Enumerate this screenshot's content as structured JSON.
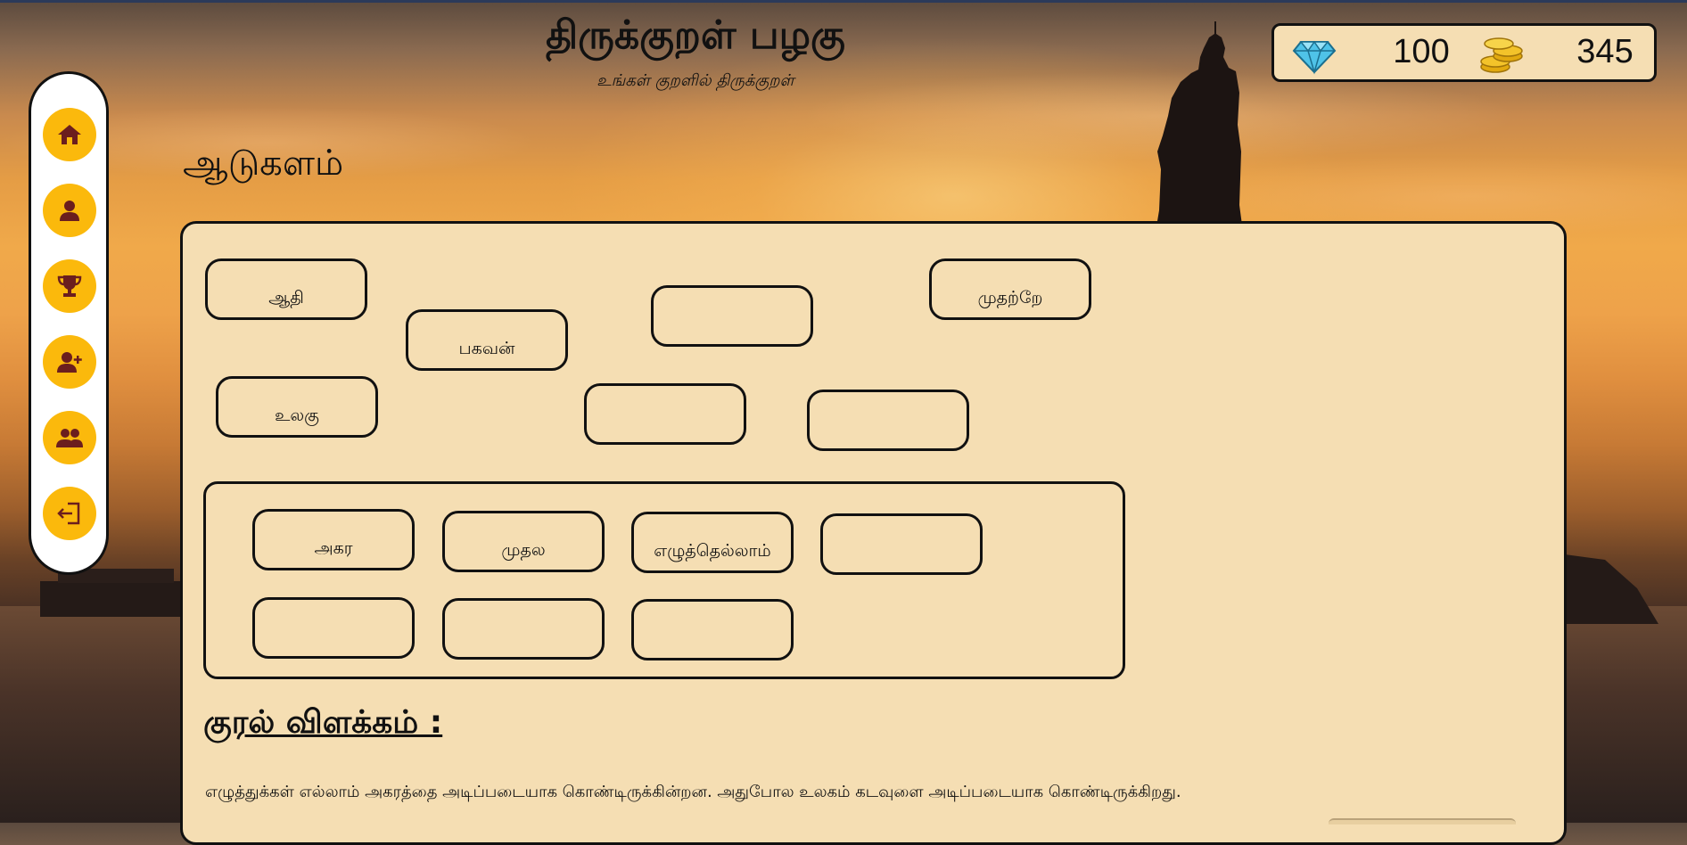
{
  "app": {
    "title": "திருக்குறள் பழகு",
    "subtitle": "உங்கள் குறளில் திருக்குறள்"
  },
  "wallet": {
    "gem_icon": "diamond-icon",
    "gems": "100",
    "coin_icon": "coins-icon",
    "coins": "345"
  },
  "sidebar": {
    "items": [
      {
        "id": "home",
        "icon": "home-icon"
      },
      {
        "id": "profile",
        "icon": "user-icon"
      },
      {
        "id": "leaderboard",
        "icon": "trophy-icon"
      },
      {
        "id": "add-friend",
        "icon": "user-plus-icon"
      },
      {
        "id": "friends",
        "icon": "users-icon"
      },
      {
        "id": "logout",
        "icon": "logout-icon"
      }
    ]
  },
  "section": {
    "title": "ஆடுகளம்"
  },
  "word_pool": [
    {
      "label": "ஆதி"
    },
    {
      "label": "பகவன்"
    },
    {
      "label": ""
    },
    {
      "label": "முதற்றே"
    },
    {
      "label": "உலகு"
    },
    {
      "label": ""
    },
    {
      "label": ""
    }
  ],
  "answer_slots": [
    {
      "label": "அகர"
    },
    {
      "label": "முதல"
    },
    {
      "label": "எழுத்தெல்லாம்"
    },
    {
      "label": ""
    },
    {
      "label": ""
    },
    {
      "label": ""
    },
    {
      "label": ""
    }
  ],
  "meaning": {
    "title": "குரல் விளக்கம் :",
    "text": "எழுத்துக்கள் எல்லாம் அகரத்தை அடிப்படையாக கொண்டிருக்கின்றன. அதுபோல உலகம் கடவுளை அடிப்படையாக கொண்டிருக்கிறது."
  },
  "colors": {
    "accent": "#fbb90c",
    "panel": "#f5deb3",
    "icon": "#6b1e1e"
  }
}
